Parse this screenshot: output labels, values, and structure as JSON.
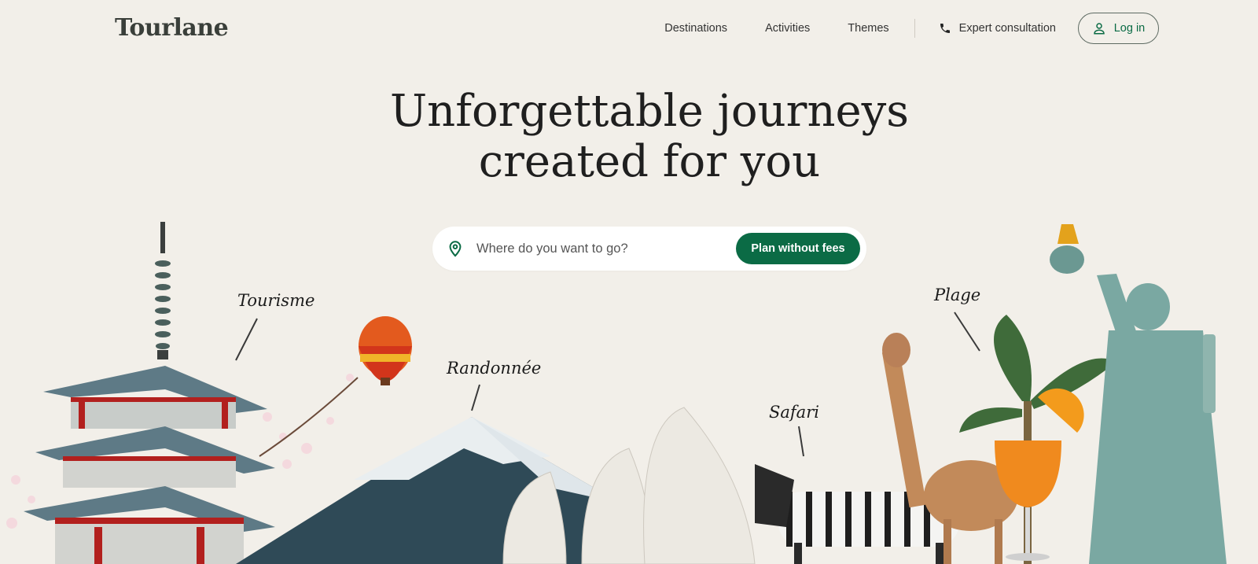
{
  "brand": {
    "logo": "Tourlane"
  },
  "nav": {
    "items": [
      {
        "label": "Destinations"
      },
      {
        "label": "Activities"
      },
      {
        "label": "Themes"
      }
    ],
    "expert": "Expert consultation",
    "login": "Log in"
  },
  "hero": {
    "line1": "Unforgettable journeys",
    "line2": "created for you"
  },
  "search": {
    "placeholder": "Where do you want to go?",
    "button": "Plan without fees"
  },
  "annotations": {
    "tourisme": "Tourisme",
    "randonnee": "Randonnée",
    "safari": "Safari",
    "plage": "Plage"
  },
  "colors": {
    "background": "#f2efe9",
    "brand_green": "#0b6b45",
    "text": "#1f1f1f"
  },
  "icons": [
    "phone-icon",
    "user-icon",
    "location-pin-icon"
  ]
}
